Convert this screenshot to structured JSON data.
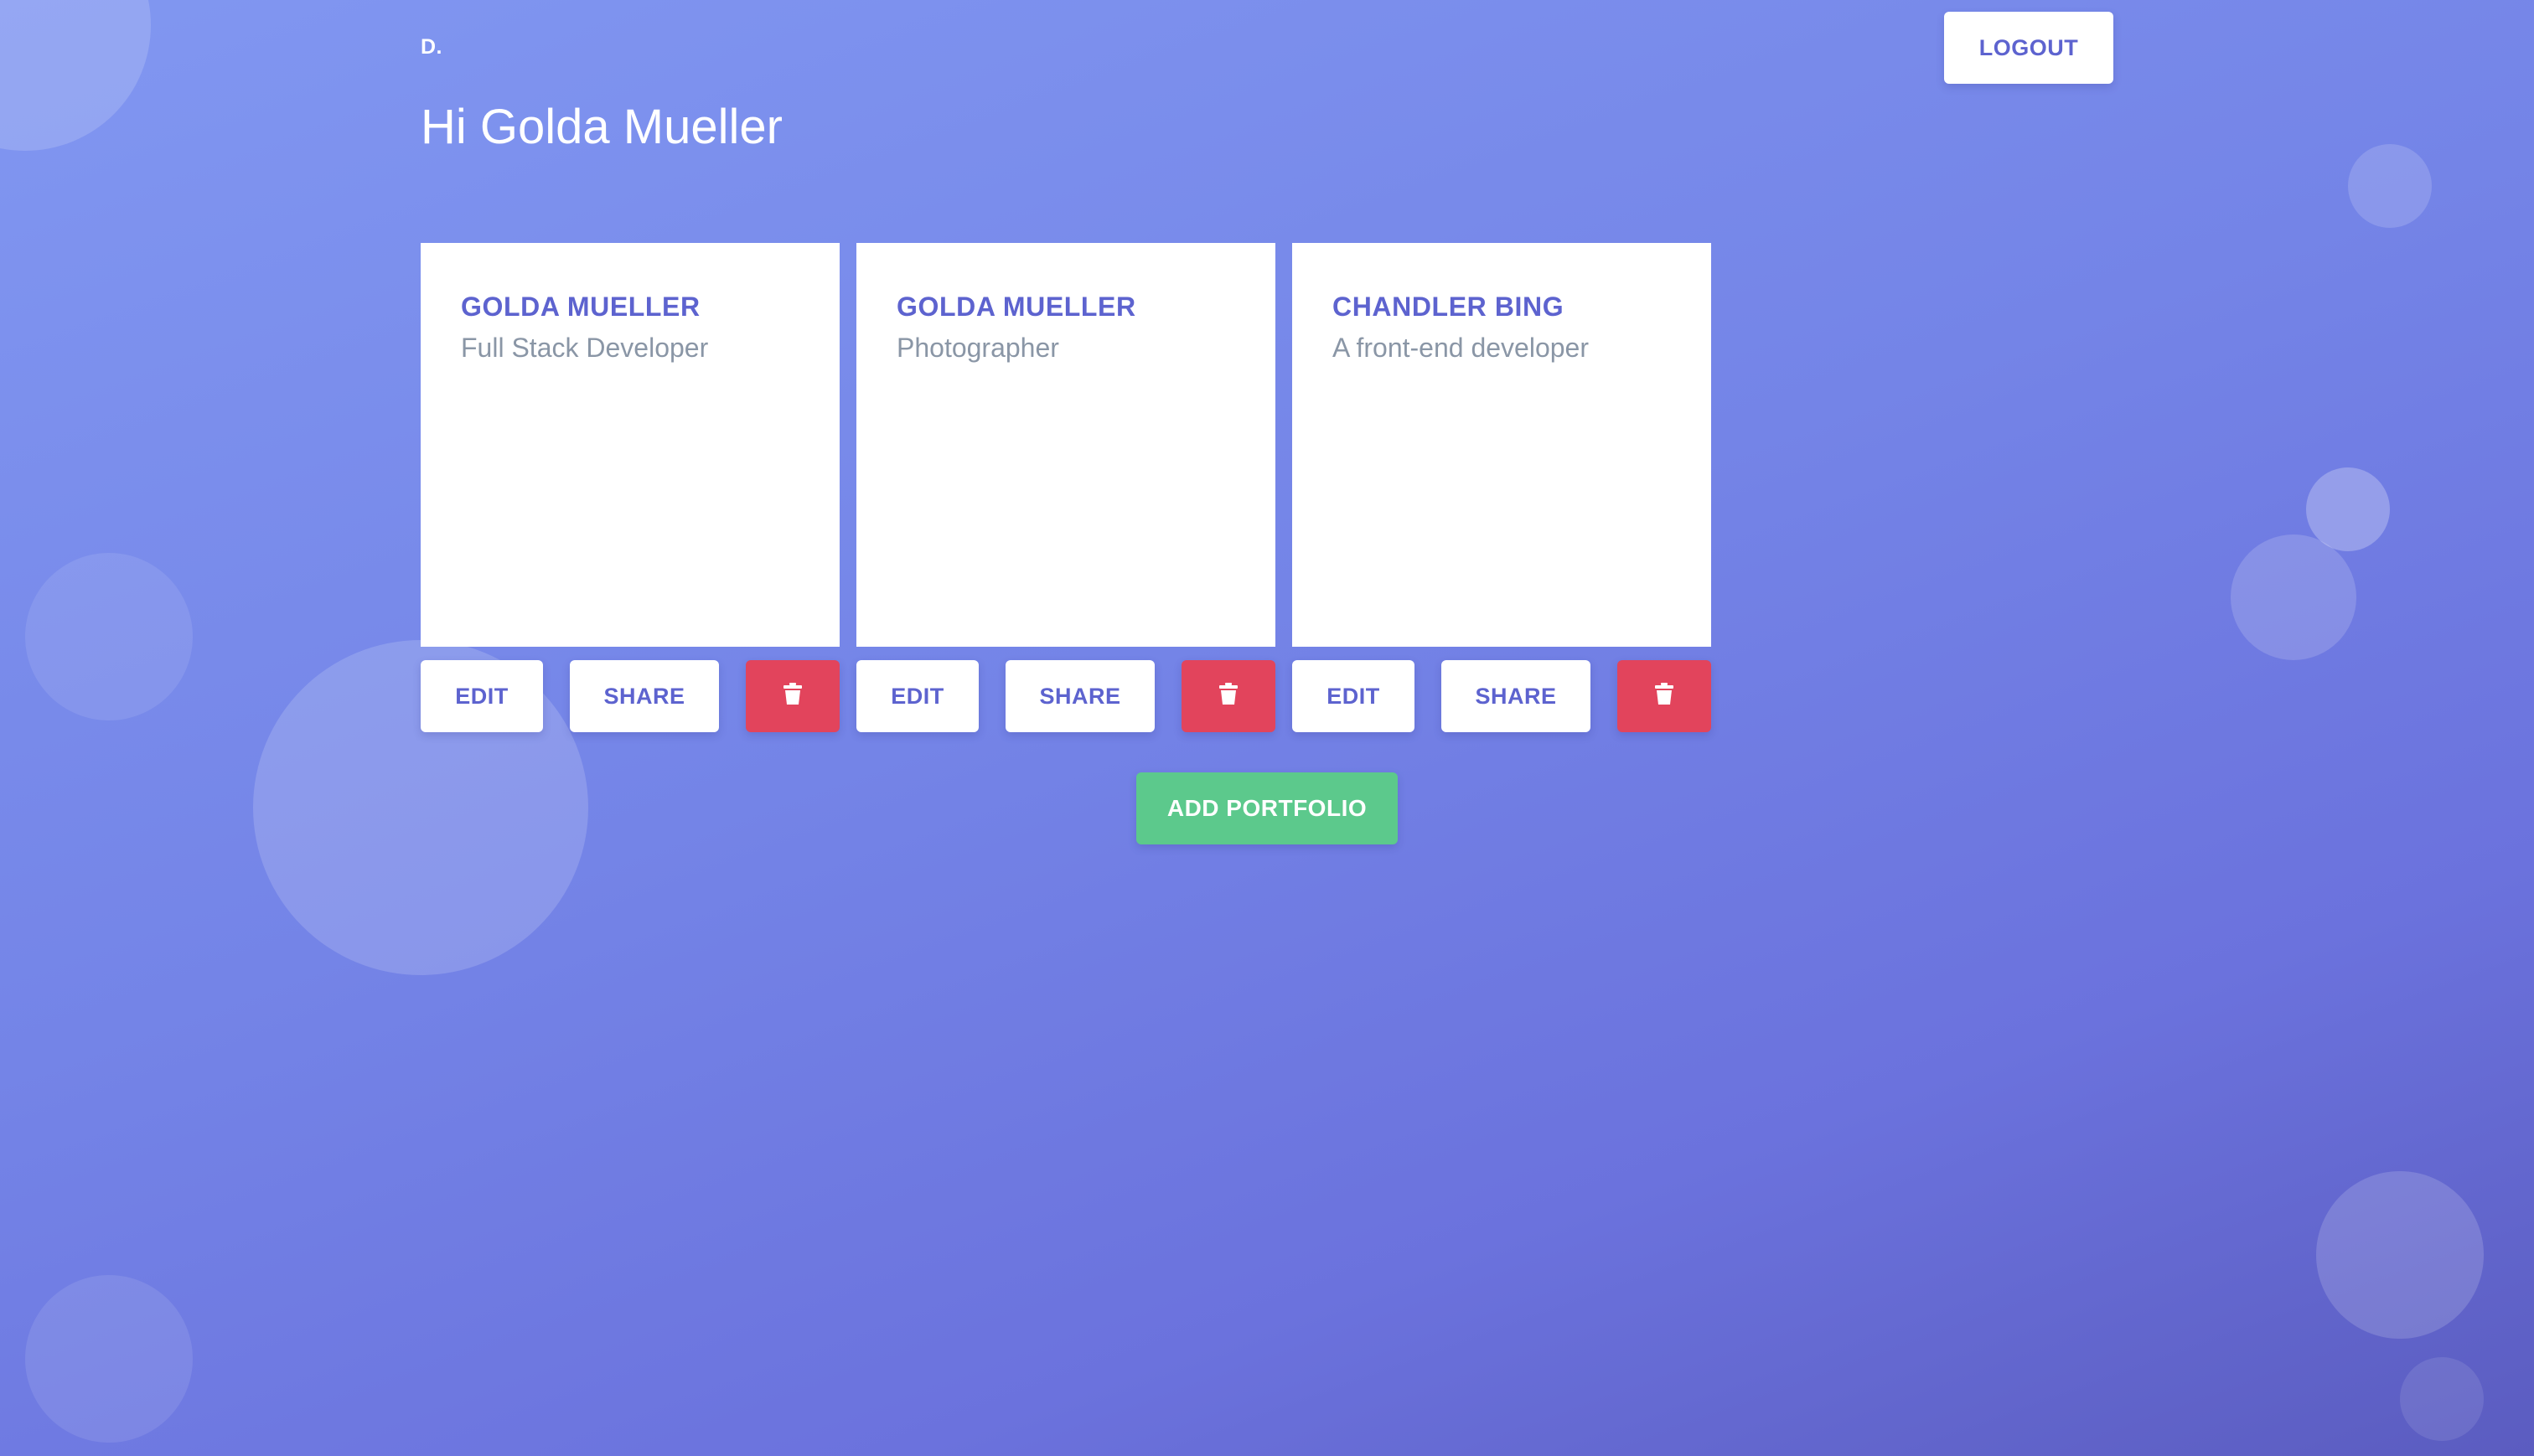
{
  "header": {
    "logo": "D.",
    "greeting": "Hi Golda Mueller",
    "logout_label": "LOGOUT"
  },
  "portfolios": [
    {
      "name": "GOLDA MUELLER",
      "role": "Full Stack Developer",
      "edit_label": "EDIT",
      "share_label": "SHARE",
      "delete_icon": "trash-icon"
    },
    {
      "name": "GOLDA MUELLER",
      "role": "Photographer",
      "edit_label": "EDIT",
      "share_label": "SHARE",
      "delete_icon": "trash-icon"
    },
    {
      "name": "CHANDLER BING",
      "role": "A front-end developer",
      "edit_label": "EDIT",
      "share_label": "SHARE",
      "delete_icon": "trash-icon"
    }
  ],
  "add_portfolio_label": "ADD PORTFOLIO",
  "colors": {
    "accent": "#5d63cf",
    "danger": "#e2445c",
    "success": "#5cc98c",
    "background_start": "#8197f1",
    "background_end": "#5b5cc0",
    "muted_text": "#8a96a6"
  }
}
